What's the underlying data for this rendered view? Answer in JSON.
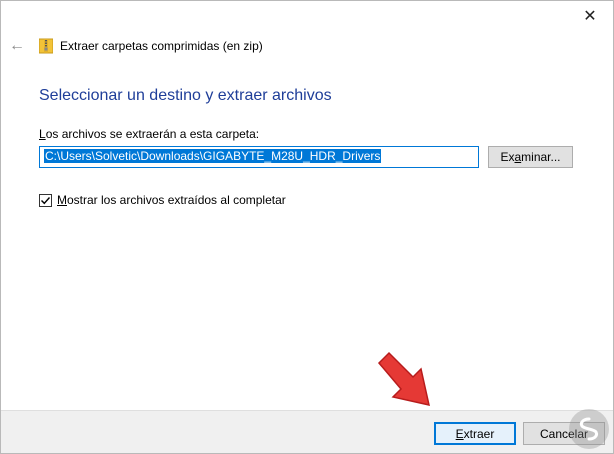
{
  "window": {
    "title": "Extraer carpetas comprimidas (en zip)",
    "close_glyph": "✕",
    "back_glyph": "←"
  },
  "main": {
    "heading": "Seleccionar un destino y extraer archivos",
    "destination_label_prefix": "L",
    "destination_label_rest": "os archivos se extraerán a esta carpeta:",
    "destination_path": "C:\\Users\\Solvetic\\Downloads\\GIGABYTE_M28U_HDR_Drivers",
    "browse_prefix": "Ex",
    "browse_underlined": "a",
    "browse_rest": "minar...",
    "show_files_checked": true,
    "show_files_prefix": "",
    "show_files_underlined": "M",
    "show_files_rest": "ostrar los archivos extraídos al completar"
  },
  "footer": {
    "extract_underlined": "E",
    "extract_rest": "xtraer",
    "cancel_label": "Cancelar"
  },
  "colors": {
    "heading": "#1f3e99",
    "accent": "#0078d7",
    "arrow": "#e53935"
  },
  "icons": {
    "back": "back-arrow-icon",
    "zip": "zip-folder-icon",
    "close": "close-icon",
    "check": "checkmark-icon",
    "pointer": "red-pointer-arrow-icon",
    "watermark": "watermark-logo-icon"
  }
}
